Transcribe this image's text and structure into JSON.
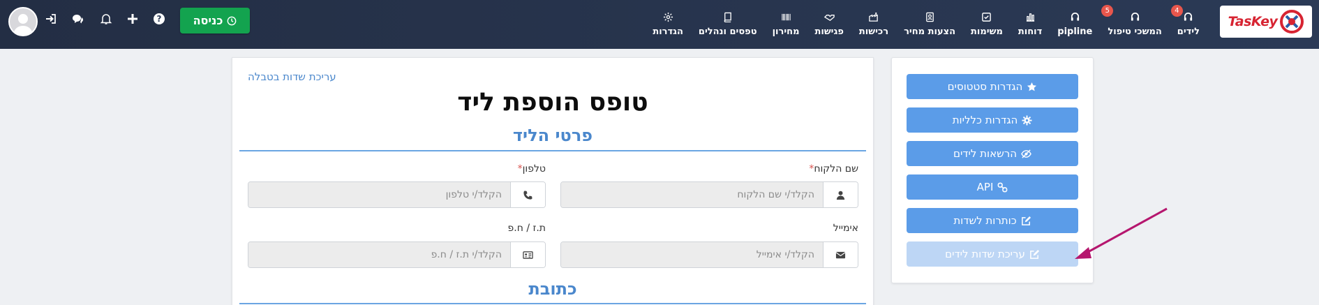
{
  "app": {
    "logo_text": "TasKey",
    "colors": {
      "navbar": "#2b3a56",
      "accent": "#5b9ce8",
      "checkin": "#13a34f",
      "badge": "#e8564c",
      "section": "#4a87cc"
    }
  },
  "nav": {
    "items": [
      {
        "label": "לידים",
        "icon": "headset-icon",
        "badge": "4"
      },
      {
        "label": "המשכי טיפול",
        "icon": "headset-icon",
        "badge": "5"
      },
      {
        "label": "pipline",
        "icon": "headset-icon",
        "badge": ""
      },
      {
        "label": "דוחות",
        "icon": "bar-chart-icon",
        "badge": ""
      },
      {
        "label": "משימות",
        "icon": "checkbox-icon",
        "badge": ""
      },
      {
        "label": "הצעות מחיר",
        "icon": "id-card-icon",
        "badge": ""
      },
      {
        "label": "רכישות",
        "icon": "building-icon",
        "badge": ""
      },
      {
        "label": "פגישות",
        "icon": "handshake-icon",
        "badge": ""
      },
      {
        "label": "מחירון",
        "icon": "barcode-icon",
        "badge": ""
      },
      {
        "label": "טפסים ונהלים",
        "icon": "book-icon",
        "badge": ""
      },
      {
        "label": "הגדרות",
        "icon": "gear-icon",
        "badge": ""
      }
    ],
    "checkin_label": "כניסה"
  },
  "sidebar": {
    "buttons": [
      {
        "label": "הגדרות סטטוסים",
        "icon": "star-icon"
      },
      {
        "label": "הגדרות כלליות",
        "icon": "gear-icon"
      },
      {
        "label": "הרשאות לידים",
        "icon": "eye-slash-icon"
      },
      {
        "label": "API",
        "icon": "link-icon"
      },
      {
        "label": "כותרות לשדות",
        "icon": "edit-icon"
      },
      {
        "label": "עריכת שדות לידים",
        "icon": "edit-icon"
      }
    ]
  },
  "form": {
    "edit_link": "עריכת שדות בטבלה",
    "title": "טופס הוספת ליד",
    "section_details": "פרטי הליד",
    "section_address": "כתובת",
    "fields": {
      "name": {
        "label": "שם הלקוח",
        "required": "*",
        "placeholder": "הקלד/י שם הלקוח",
        "icon": "user-icon"
      },
      "phone": {
        "label": "טלפון",
        "required": "*",
        "placeholder": "הקלד/י טלפון",
        "icon": "phone-icon"
      },
      "email": {
        "label": "אימייל",
        "placeholder": "הקלד/י אימייל",
        "icon": "envelope-icon"
      },
      "id": {
        "label": "ת.ז / ח.פ",
        "placeholder": "הקלד/י ת.ז / ח.פ",
        "icon": "id-card-icon"
      }
    }
  }
}
